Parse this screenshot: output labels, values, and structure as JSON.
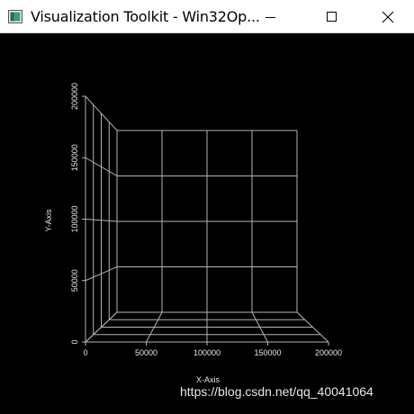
{
  "window": {
    "title": "Visualization Toolkit - Win32Op...",
    "icon": "vtk-app-icon",
    "controls": [
      "minimize-icon",
      "maximize-icon",
      "close-icon"
    ]
  },
  "plot": {
    "xlabel": "X-Axis",
    "ylabel": "Y-Axis",
    "x_ticks": [
      "0",
      "50000",
      "100000",
      "150000",
      "200000"
    ],
    "y_ticks": [
      "0",
      "50000",
      "100000",
      "150000",
      "200000"
    ],
    "xlim": [
      0,
      200000
    ],
    "ylim": [
      0,
      200000
    ],
    "grid": true,
    "grid_color": "#b4b4b4",
    "background": "#000000"
  },
  "watermark": "https://blog.csdn.net/qq_40041064"
}
